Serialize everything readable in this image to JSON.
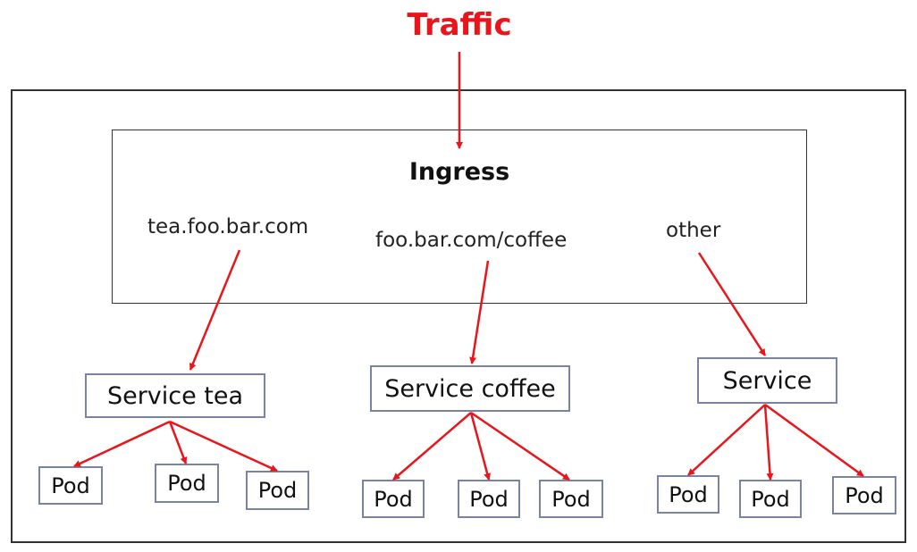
{
  "title": "Traffic",
  "ingress": {
    "label": "Ingress",
    "rules": [
      "tea.foo.bar.com",
      "foo.bar.com/coffee",
      "other"
    ]
  },
  "services": [
    {
      "label": "Service tea",
      "pods": [
        "Pod",
        "Pod",
        "Pod"
      ]
    },
    {
      "label": "Service coffee",
      "pods": [
        "Pod",
        "Pod",
        "Pod"
      ]
    },
    {
      "label": "Service",
      "pods": [
        "Pod",
        "Pod",
        "Pod"
      ]
    }
  ],
  "colors": {
    "arrow": "#e8151b",
    "title": "#e8151b",
    "box_border": "#7a84a0",
    "frame": "#333333"
  }
}
